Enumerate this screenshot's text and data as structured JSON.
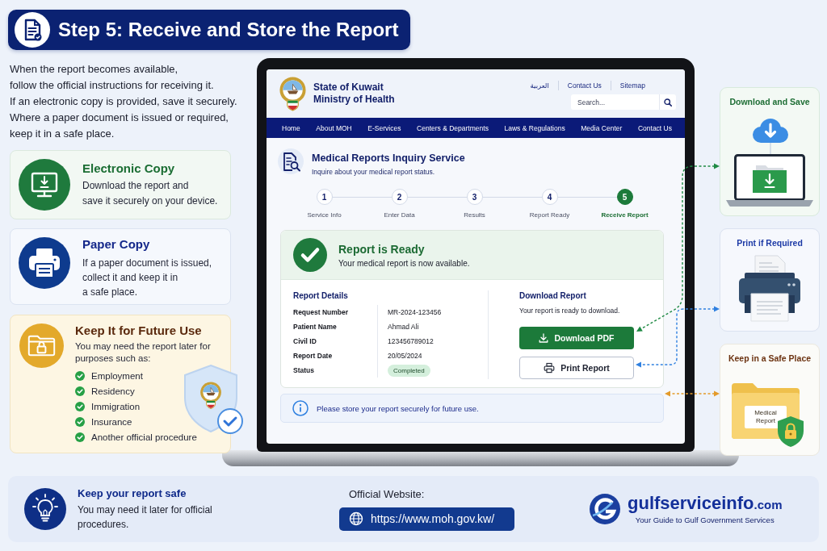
{
  "title": {
    "text": "Step 5: Receive and Store the Report"
  },
  "intro": "When the report becomes available,\nfollow the official instructions for receiving it.\nIf an electronic copy is provided, save it securely.\nWhere a paper document is issued or required,\nkeep it in a safe place.",
  "info_cards": [
    {
      "kind": "electronic",
      "title": "Electronic Copy",
      "text": "Download the report and\nsave it securely on your device."
    },
    {
      "kind": "paper",
      "title": "Paper Copy",
      "text": "If a paper document is issued,\ncollect it and keep it in\na safe place."
    },
    {
      "kind": "storage",
      "title": "Keep It for Future Use",
      "text": "You may need the report later for\npurposes such as:",
      "purposes": [
        "Employment",
        "Residency",
        "Immigration",
        "Insurance",
        "Another official procedure"
      ]
    }
  ],
  "website_screen": {
    "org": "State of Kuwait",
    "ministry": "Ministry of Health",
    "top_links": [
      "العربية",
      "Contact Us",
      "Sitemap"
    ],
    "search": {
      "placeholder": "Search..."
    },
    "nav": [
      "Home",
      "About MOH",
      "E-Services",
      "Centers & Departments",
      "Laws & Regulations",
      "Media Center",
      "Contact Us"
    ],
    "service": {
      "title": "Medical Reports Inquiry Service",
      "subtitle": "Inquire about your medical report status."
    },
    "steps": [
      {
        "number": "1",
        "label": "Service Info",
        "current": false
      },
      {
        "number": "2",
        "label": "Enter Data",
        "current": false
      },
      {
        "number": "3",
        "label": "Results",
        "current": false
      },
      {
        "number": "4",
        "label": "Report Ready",
        "current": false
      },
      {
        "number": "5",
        "label": "Receive Report",
        "current": true
      }
    ],
    "status": {
      "title": "Report is Ready",
      "text": "Your medical report is now available."
    },
    "details": {
      "heading": "Report Details",
      "rows": [
        {
          "kind": "text",
          "label": "Request Number",
          "value": "MR-2024-123456"
        },
        {
          "kind": "text",
          "label": "Patient Name",
          "value": "Ahmad Ali"
        },
        {
          "kind": "text",
          "label": "Civil ID",
          "value": "123456789012"
        },
        {
          "kind": "text",
          "label": "Report Date",
          "value": "20/05/2024"
        },
        {
          "kind": "badge",
          "label": "Status",
          "value": "Completed"
        }
      ]
    },
    "download": {
      "heading": "Download Report",
      "text": "Your report is ready to download.",
      "buttons": [
        {
          "kind": "primary",
          "label": "Download PDF"
        },
        {
          "kind": "outline",
          "label": "Print Report"
        }
      ]
    },
    "notice": "Please store your report securely for future use."
  },
  "side_cards": [
    {
      "kind": "download",
      "title": "Download and Save"
    },
    {
      "kind": "print",
      "title": "Print if Required"
    },
    {
      "kind": "storage",
      "title": "Keep in a Safe Place",
      "paper_label": "Medical Report"
    }
  ],
  "footer": {
    "tip": {
      "title": "Keep your report safe",
      "text": "You may need it later for official\nprocedures."
    },
    "website": {
      "label": "Official Website:",
      "url": "https://www.moh.gov.kw/"
    },
    "brand": {
      "name": "gulfserviceinfo",
      "domain": ".com",
      "tagline": "Your Guide to Gulf Government Services"
    }
  }
}
